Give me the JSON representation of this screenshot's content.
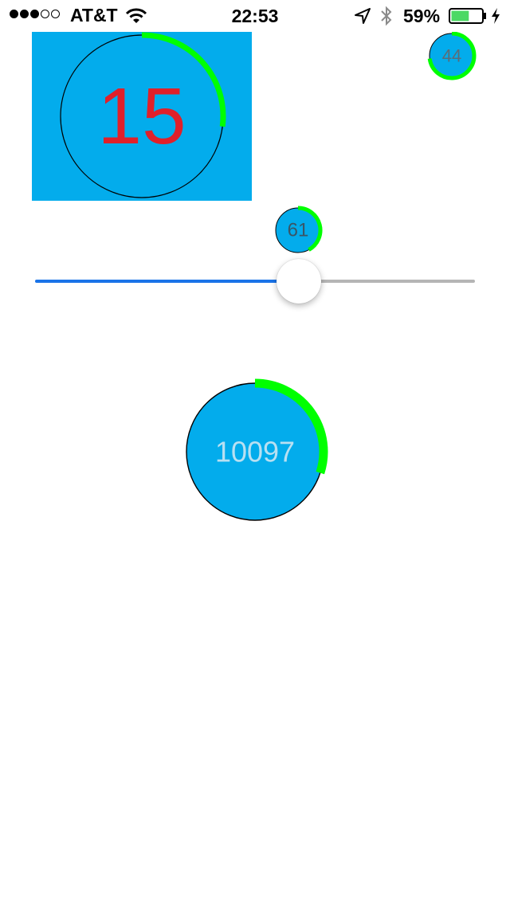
{
  "status_bar": {
    "signal_bars_filled": 3,
    "signal_bars_total": 5,
    "carrier": "AT&T",
    "time": "22:53",
    "battery_percent": "59%",
    "battery_level": 0.59,
    "icons": [
      "wifi-icon",
      "location-arrow-icon",
      "bluetooth-icon",
      "battery-icon",
      "charging-bolt-icon"
    ]
  },
  "gauges": {
    "large_panel": {
      "value": "15",
      "progress": 0.27
    },
    "small_top_right": {
      "value": "44",
      "progress": 0.73
    },
    "slider_badge": {
      "value": "61",
      "progress": 0.42
    },
    "center": {
      "value": "10097",
      "progress": 0.3
    }
  },
  "slider": {
    "value": 0.6
  },
  "colors": {
    "gauge_fill": "#03ACEC",
    "progress_arc": "#00FF00",
    "large_number": "#E0202A",
    "slider_track_min": "#1A73E8",
    "slider_track_max": "#B5B5B5"
  }
}
